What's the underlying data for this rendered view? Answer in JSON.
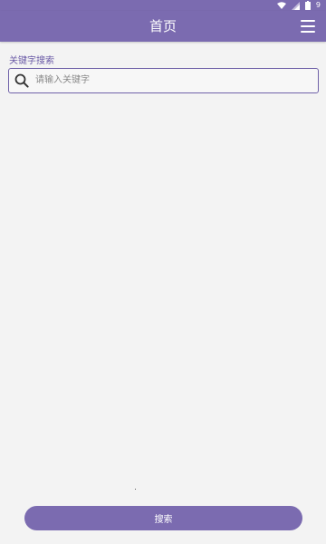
{
  "status_bar": {
    "icons": [
      "wifi-icon",
      "signal-icon",
      "battery-icon"
    ],
    "time": "9"
  },
  "app_bar": {
    "title": "首页",
    "menu_icon": "hamburger-menu-icon"
  },
  "search": {
    "label": "关键字搜索",
    "placeholder": "请输入关键字",
    "value": "",
    "icon": "search-icon"
  },
  "actions": {
    "search_button_label": "搜索"
  },
  "colors": {
    "primary": "#7b6bb0",
    "accent_text": "#6a5aa6",
    "background": "#f3f3f3"
  }
}
